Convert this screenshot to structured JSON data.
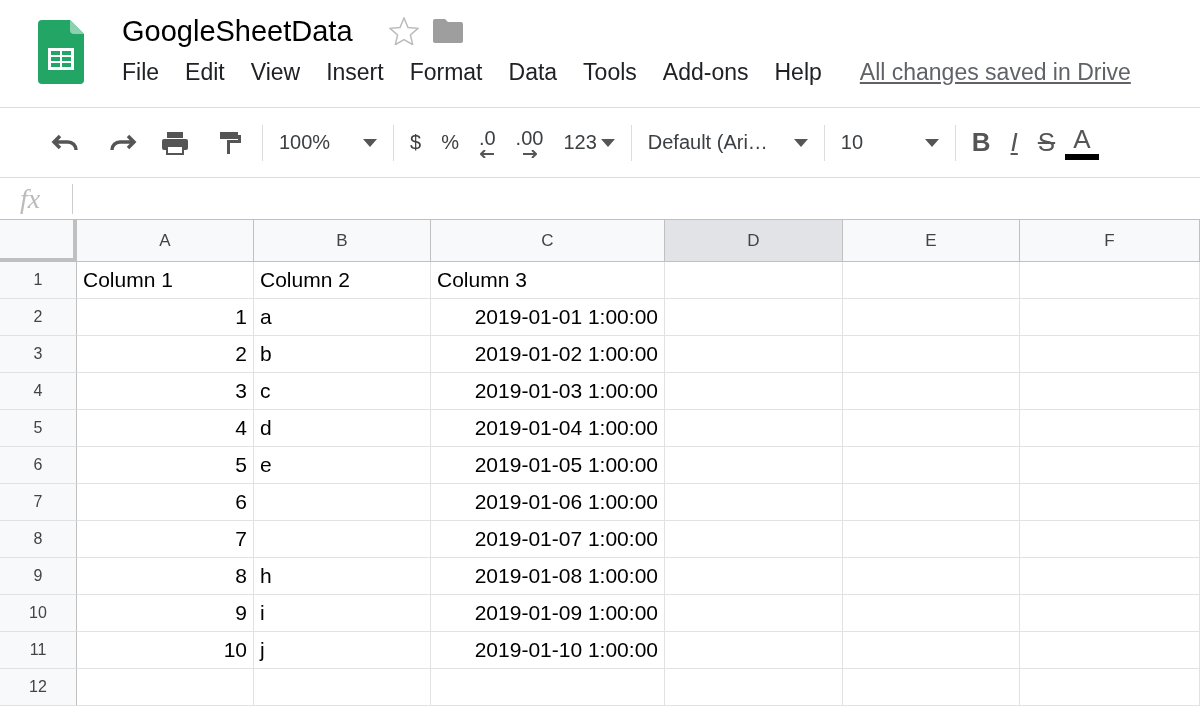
{
  "document": {
    "title": "GoogleSheetData",
    "save_status": "All changes saved in Drive"
  },
  "menu": [
    "File",
    "Edit",
    "View",
    "Insert",
    "Format",
    "Data",
    "Tools",
    "Add-ons",
    "Help"
  ],
  "toolbar": {
    "zoom": "100%",
    "currency": "$",
    "percent": "%",
    "decrease_decimals": ".0",
    "increase_decimals": ".00",
    "number_format": "123",
    "font": "Default (Ari…",
    "font_size": "10",
    "bold": "B",
    "italic": "I",
    "strikethrough": "S",
    "text_color": "A"
  },
  "formula_bar": {
    "label": "fx"
  },
  "columns": [
    {
      "label": "A",
      "selected": false
    },
    {
      "label": "B",
      "selected": false
    },
    {
      "label": "C",
      "selected": false
    },
    {
      "label": "D",
      "selected": true
    },
    {
      "label": "E",
      "selected": false
    },
    {
      "label": "F",
      "selected": false
    }
  ],
  "rows": [
    {
      "number": "1",
      "cells": [
        {
          "kind": "text",
          "value": "Column 1"
        },
        {
          "kind": "text",
          "value": "Column 2"
        },
        {
          "kind": "text",
          "value": "Column 3"
        }
      ]
    },
    {
      "number": "2",
      "cells": [
        {
          "kind": "number",
          "value": "1"
        },
        {
          "kind": "text",
          "value": "a"
        },
        {
          "kind": "number",
          "value": "2019-01-01 1:00:00"
        }
      ]
    },
    {
      "number": "3",
      "cells": [
        {
          "kind": "number",
          "value": "2"
        },
        {
          "kind": "text",
          "value": "b"
        },
        {
          "kind": "number",
          "value": "2019-01-02 1:00:00"
        }
      ]
    },
    {
      "number": "4",
      "cells": [
        {
          "kind": "number",
          "value": "3"
        },
        {
          "kind": "text",
          "value": "c"
        },
        {
          "kind": "number",
          "value": "2019-01-03 1:00:00"
        }
      ]
    },
    {
      "number": "5",
      "cells": [
        {
          "kind": "number",
          "value": "4"
        },
        {
          "kind": "text",
          "value": "d"
        },
        {
          "kind": "number",
          "value": "2019-01-04 1:00:00"
        }
      ]
    },
    {
      "number": "6",
      "cells": [
        {
          "kind": "number",
          "value": "5"
        },
        {
          "kind": "text",
          "value": "e"
        },
        {
          "kind": "number",
          "value": "2019-01-05 1:00:00"
        }
      ]
    },
    {
      "number": "7",
      "cells": [
        {
          "kind": "number",
          "value": "6"
        },
        {
          "kind": "empty"
        },
        {
          "kind": "number",
          "value": "2019-01-06 1:00:00"
        }
      ]
    },
    {
      "number": "8",
      "cells": [
        {
          "kind": "number",
          "value": "7"
        },
        {
          "kind": "empty"
        },
        {
          "kind": "number",
          "value": "2019-01-07 1:00:00"
        }
      ]
    },
    {
      "number": "9",
      "cells": [
        {
          "kind": "number",
          "value": "8"
        },
        {
          "kind": "text",
          "value": "h"
        },
        {
          "kind": "number",
          "value": "2019-01-08 1:00:00"
        }
      ]
    },
    {
      "number": "10",
      "cells": [
        {
          "kind": "number",
          "value": "9"
        },
        {
          "kind": "text",
          "value": "i"
        },
        {
          "kind": "number",
          "value": "2019-01-09 1:00:00"
        }
      ]
    },
    {
      "number": "11",
      "cells": [
        {
          "kind": "number",
          "value": "10"
        },
        {
          "kind": "text",
          "value": "j"
        },
        {
          "kind": "number",
          "value": "2019-01-10 1:00:00"
        }
      ]
    },
    {
      "number": "12",
      "cells": []
    }
  ]
}
